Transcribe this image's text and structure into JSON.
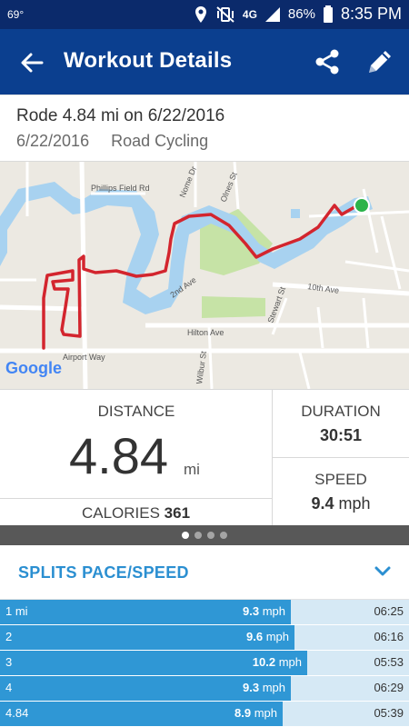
{
  "status_bar": {
    "temperature": "69°",
    "network": "4G",
    "battery": "86%",
    "time": "8:35 PM"
  },
  "app_bar": {
    "title": "Workout Details",
    "icons": [
      "back-arrow-icon",
      "share-icon",
      "edit-pencil-icon"
    ]
  },
  "summary": {
    "headline": "Rode 4.84 mi on 6/22/2016",
    "date": "6/22/2016",
    "activity": "Road Cycling"
  },
  "map": {
    "brand": "Google",
    "streets": [
      "Phillips Field Rd",
      "Nome Dr",
      "Olnes St",
      "2nd Ave",
      "10th Ave",
      "Stewart St",
      "Hilton Ave",
      "Airport Way",
      "Wilbur St"
    ],
    "colors": {
      "route": "#d3252e",
      "water": "#a8d2f0",
      "park": "#c6e3a6",
      "end_marker": "#2bb34a"
    }
  },
  "stats": {
    "distance_label": "DISTANCE",
    "distance_value": "4.84",
    "distance_unit": "mi",
    "calories_label": "CALORIES",
    "calories_value": "361",
    "duration_label": "DURATION",
    "duration_value": "30:51",
    "speed_label": "SPEED",
    "speed_value": "9.4",
    "speed_unit": "mph"
  },
  "pager": {
    "pages": 4,
    "active": 0
  },
  "splits": {
    "header": "SPLITS PACE/SPEED",
    "rows": [
      {
        "mile": "1 mi",
        "speed": "9.3",
        "unit": "mph",
        "time": "06:25",
        "bar_fraction": 0.71
      },
      {
        "mile": "2",
        "speed": "9.6",
        "unit": "mph",
        "time": "06:16",
        "bar_fraction": 0.72
      },
      {
        "mile": "3",
        "speed": "10.2",
        "unit": "mph",
        "time": "05:53",
        "bar_fraction": 0.75
      },
      {
        "mile": "4",
        "speed": "9.3",
        "unit": "mph",
        "time": "06:29",
        "bar_fraction": 0.71
      },
      {
        "mile": "4.84",
        "speed": "8.9",
        "unit": "mph",
        "time": "05:39",
        "bar_fraction": 0.69
      }
    ]
  },
  "colors": {
    "status_bar": "#0b2a6b",
    "app_bar": "#0b3f8f",
    "accent": "#2b8fd1",
    "split_bar": "#2f97d5",
    "split_bg": "#d6e9f5"
  }
}
